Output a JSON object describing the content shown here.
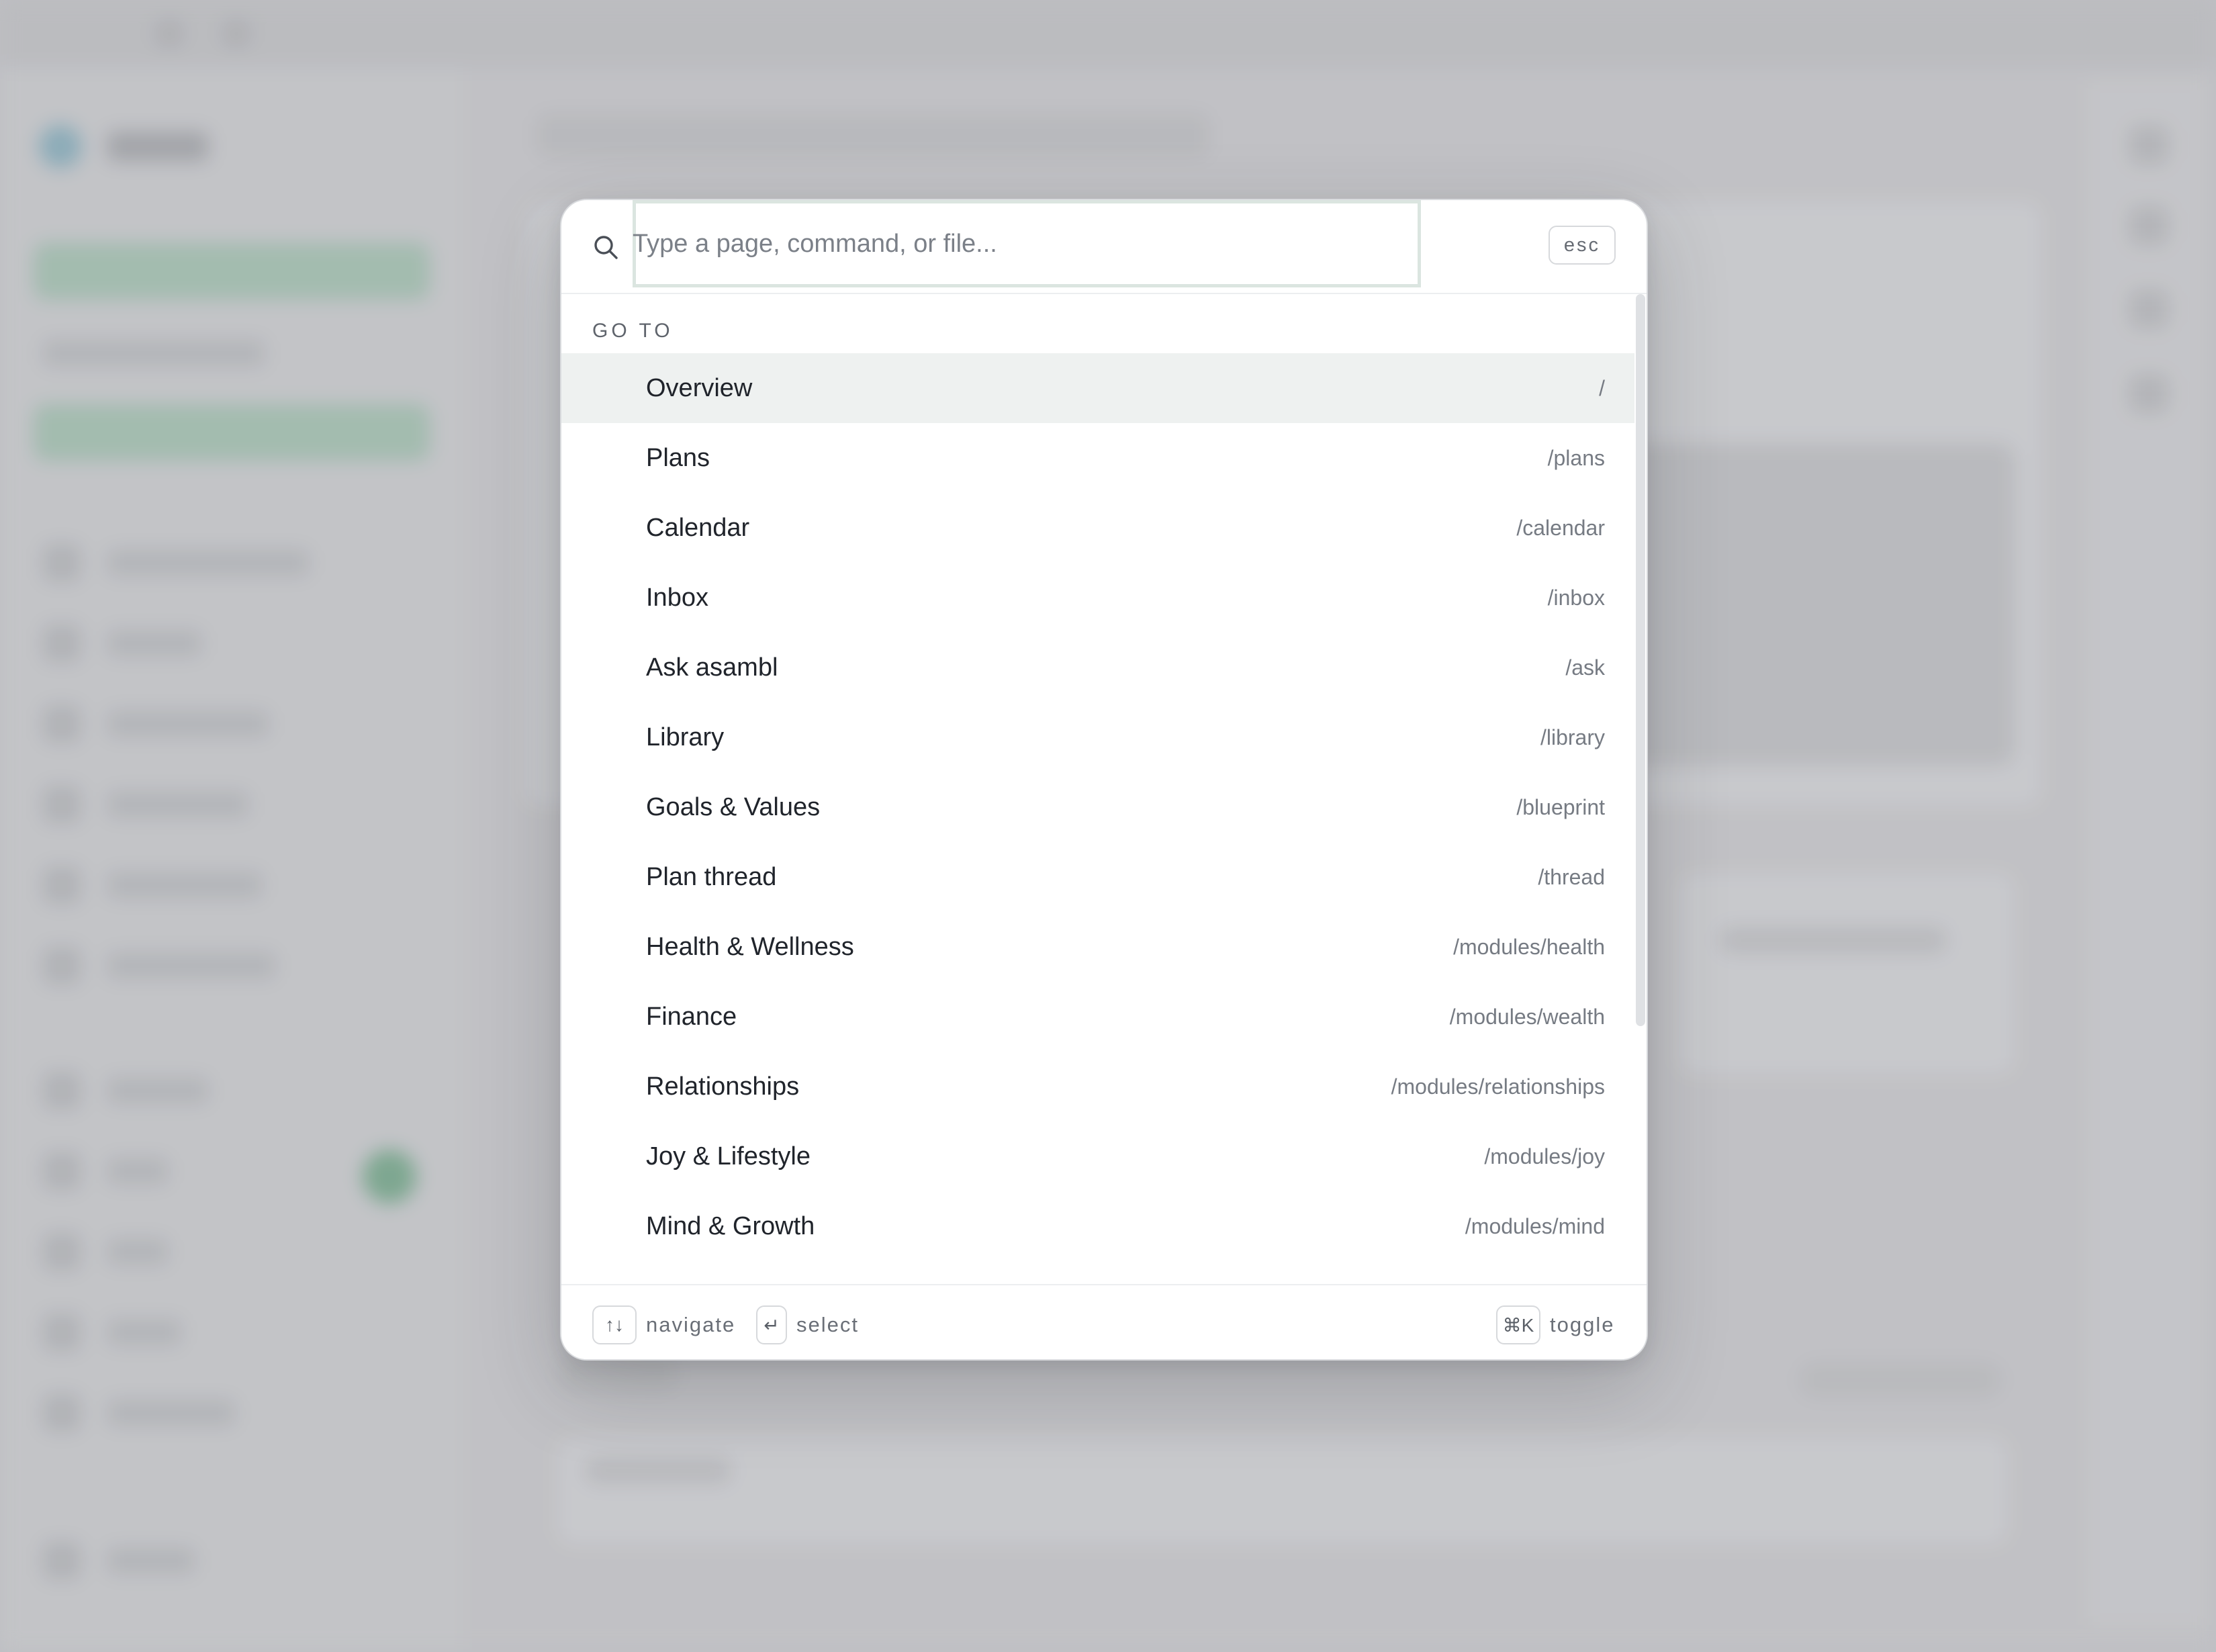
{
  "palette": {
    "search_placeholder": "Type a page, command, or file...",
    "esc_label": "esc",
    "section_label": "GO TO",
    "items": [
      {
        "label": "Overview",
        "path": "/"
      },
      {
        "label": "Plans",
        "path": "/plans"
      },
      {
        "label": "Calendar",
        "path": "/calendar"
      },
      {
        "label": "Inbox",
        "path": "/inbox"
      },
      {
        "label": "Ask asambl",
        "path": "/ask"
      },
      {
        "label": "Library",
        "path": "/library"
      },
      {
        "label": "Goals & Values",
        "path": "/blueprint"
      },
      {
        "label": "Plan thread",
        "path": "/thread"
      },
      {
        "label": "Health & Wellness",
        "path": "/modules/health"
      },
      {
        "label": "Finance",
        "path": "/modules/wealth"
      },
      {
        "label": "Relationships",
        "path": "/modules/relationships"
      },
      {
        "label": "Joy & Lifestyle",
        "path": "/modules/joy"
      },
      {
        "label": "Mind & Growth",
        "path": "/modules/mind"
      }
    ],
    "footer": {
      "navigate_key": "↑↓",
      "navigate_label": "navigate",
      "select_key": "↵",
      "select_label": "select",
      "toggle_key": "⌘K",
      "toggle_label": "toggle"
    }
  },
  "colors": {
    "accent_focus": "#dbe5e0",
    "active_row": "#eef1f0"
  }
}
